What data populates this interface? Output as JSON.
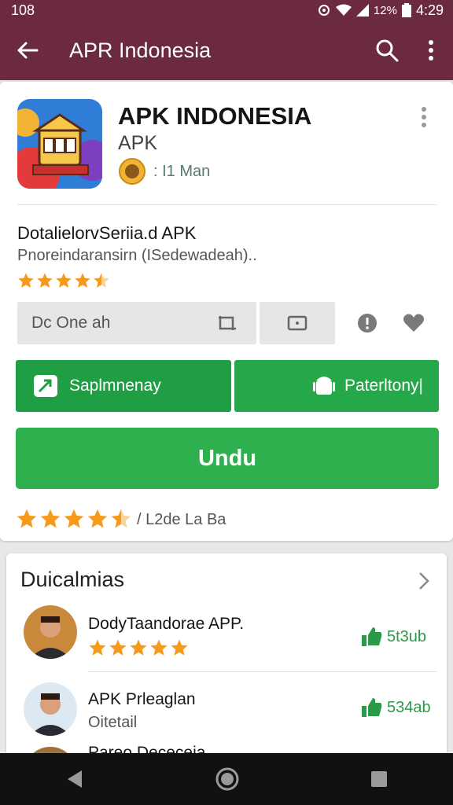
{
  "status_bar": {
    "left_text": "108",
    "battery_percent": "12%",
    "time": "4:29"
  },
  "app_bar": {
    "title": "APR Indonesia",
    "back_icon": "arrow-left-icon",
    "search_icon": "search-icon",
    "menu_icon": "more-vert-icon"
  },
  "app_header": {
    "name": "APK INDONESIA",
    "subtitle": "APK",
    "badge_text": ": I1 Man"
  },
  "description": {
    "title": "DotalielorvSeriia.d APK",
    "subtitle": "Pnoreindaransirn (ISedewadeah)..",
    "rating": 4.5
  },
  "fields": {
    "primary_value": "Dc One ah"
  },
  "buttons": {
    "left_label": "Saplmnenay",
    "right_label": "Paterltony|",
    "download_label": "Undu"
  },
  "rating_row": {
    "rating": 4.5,
    "text": "/ L2de La Ba"
  },
  "list": {
    "title": "Duicalmias",
    "items": [
      {
        "name": "DodyTaandorae APP.",
        "rating": 5,
        "sub": "",
        "count": "5t3ub"
      },
      {
        "name": "APK Prleaglan",
        "rating": null,
        "sub": "Oitetail",
        "count": "534ab"
      },
      {
        "name": "Pareo Dececeia",
        "rating": null,
        "sub": "",
        "count": ""
      }
    ]
  },
  "colors": {
    "app_bar": "#6b2a3e",
    "green": "#25a84a",
    "star": "#f59a1b"
  }
}
